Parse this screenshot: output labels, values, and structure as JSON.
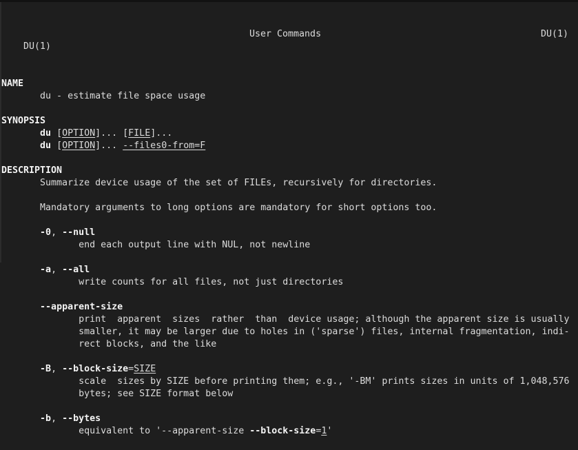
{
  "header": {
    "left": "DU(1)",
    "center": "User Commands",
    "right": "DU(1)"
  },
  "lines": [
    [],
    [
      [
        "NAME",
        "b"
      ]
    ],
    [
      [
        "       du - estimate file space usage",
        ""
      ]
    ],
    [],
    [
      [
        "SYNOPSIS",
        "b"
      ]
    ],
    [
      [
        "       ",
        ""
      ],
      [
        "du",
        "b"
      ],
      [
        " [",
        ""
      ],
      [
        "OPTION",
        "u"
      ],
      [
        "]... [",
        ""
      ],
      [
        "FILE",
        "u"
      ],
      [
        "]...",
        ""
      ]
    ],
    [
      [
        "       ",
        ""
      ],
      [
        "du",
        "b"
      ],
      [
        " [",
        ""
      ],
      [
        "OPTION",
        "u"
      ],
      [
        "]... ",
        ""
      ],
      [
        "--files0-from=F",
        "u"
      ]
    ],
    [],
    [
      [
        "DESCRIPTION",
        "b"
      ]
    ],
    [
      [
        "       Summarize device usage of the set of FILEs, recursively for directories.",
        ""
      ]
    ],
    [],
    [
      [
        "       Mandatory arguments to long options are mandatory for short options too.",
        ""
      ]
    ],
    [],
    [
      [
        "       ",
        ""
      ],
      [
        "-0",
        "b"
      ],
      [
        ", ",
        ""
      ],
      [
        "--null",
        "b"
      ]
    ],
    [
      [
        "              end each output line with NUL, not newline",
        ""
      ]
    ],
    [],
    [
      [
        "       ",
        ""
      ],
      [
        "-a",
        "b"
      ],
      [
        ", ",
        ""
      ],
      [
        "--all",
        "b"
      ]
    ],
    [
      [
        "              write counts for all files, not just directories",
        ""
      ]
    ],
    [],
    [
      [
        "       ",
        ""
      ],
      [
        "--apparent-size",
        "b"
      ]
    ],
    [
      [
        "              print  apparent  sizes  rather  than  device usage; although the apparent size is usually",
        ""
      ]
    ],
    [
      [
        "              smaller, it may be larger due to holes in ('sparse') files, internal fragmentation, indi-",
        ""
      ]
    ],
    [
      [
        "              rect blocks, and the like",
        ""
      ]
    ],
    [],
    [
      [
        "       ",
        ""
      ],
      [
        "-B",
        "b"
      ],
      [
        ", ",
        ""
      ],
      [
        "--block-size",
        "b"
      ],
      [
        "=",
        ""
      ],
      [
        "SIZE",
        "u"
      ]
    ],
    [
      [
        "              scale  sizes by SIZE before printing them; e.g., '-BM' prints sizes in units of 1,048,576",
        ""
      ]
    ],
    [
      [
        "              bytes; see SIZE format below",
        ""
      ]
    ],
    [],
    [
      [
        "       ",
        ""
      ],
      [
        "-b",
        "b"
      ],
      [
        ", ",
        ""
      ],
      [
        "--bytes",
        "b"
      ]
    ],
    [
      [
        "              equivalent to '--apparent-size ",
        ""
      ],
      [
        "--block-size",
        "b"
      ],
      [
        "=",
        ""
      ],
      [
        "1",
        "u"
      ],
      [
        "'",
        ""
      ]
    ]
  ]
}
